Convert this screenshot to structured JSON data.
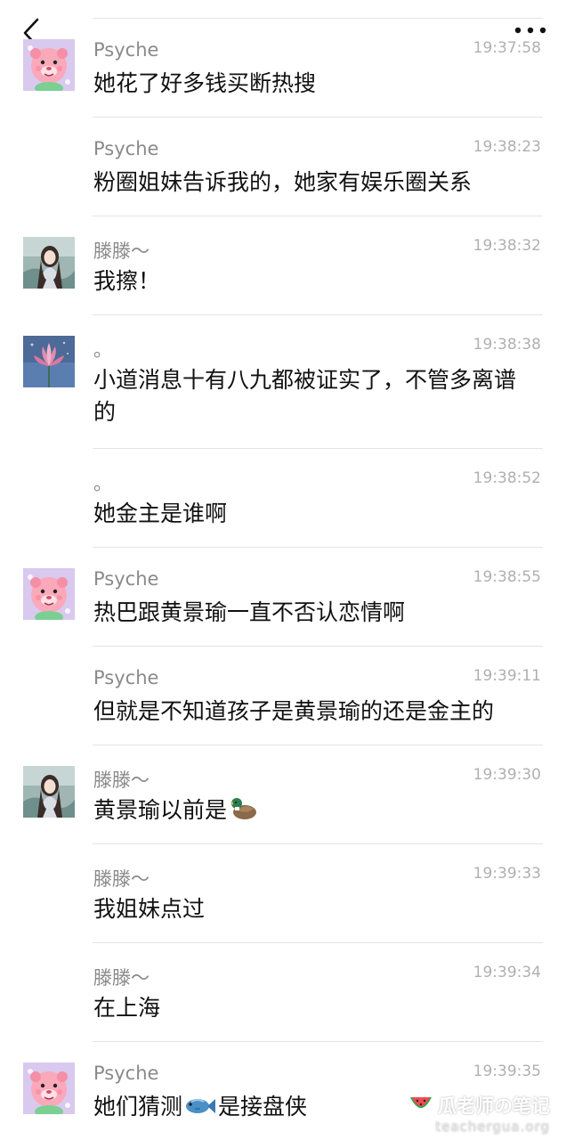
{
  "nav": {
    "back_icon": "chevron-left-icon",
    "more_icon": "more-dots-icon"
  },
  "messages": [
    {
      "sender": "Psyche",
      "time": "19:37:58",
      "text": "她花了好多钱买断热搜",
      "avatar": "pink-cartoon"
    },
    {
      "sender": "Psyche",
      "time": "19:38:23",
      "text": "粉圈姐妹告诉我的，她家有娱乐圈关系",
      "avatar": null
    },
    {
      "sender": "滕滕～",
      "time": "19:38:32",
      "text": "我擦！",
      "avatar": "girl-photo"
    },
    {
      "sender": "。",
      "time": "19:38:38",
      "text": "小道消息十有八九都被证实了，不管多离谱的",
      "avatar": "lotus-photo"
    },
    {
      "sender": "。",
      "time": "19:38:52",
      "text": "她金主是谁啊",
      "avatar": null
    },
    {
      "sender": "Psyche",
      "time": "19:38:55",
      "text": "热巴跟黄景瑜一直不否认恋情啊",
      "avatar": "pink-cartoon"
    },
    {
      "sender": "Psyche",
      "time": "19:39:11",
      "text": "但就是不知道孩子是黄景瑜的还是金主的",
      "avatar": null
    },
    {
      "sender": "滕滕～",
      "time": "19:39:30",
      "text_before": "黄景瑜以前是",
      "emoji": "duck-emoji",
      "text_after": "",
      "avatar": "girl-photo"
    },
    {
      "sender": "滕滕～",
      "time": "19:39:33",
      "text": "我姐妹点过",
      "avatar": null
    },
    {
      "sender": "滕滕～",
      "time": "19:39:34",
      "text": "在上海",
      "avatar": null
    },
    {
      "sender": "Psyche",
      "time": "19:39:35",
      "text_before": "她们猜测",
      "emoji": "fish-emoji",
      "text_after": "是接盘侠",
      "avatar": "pink-cartoon"
    }
  ],
  "watermark": {
    "title": "瓜老师の笔记",
    "url": "teachergua.org",
    "icon": "watermelon-icon"
  },
  "colors": {
    "background": "#ffffff",
    "divider": "#e4e4e4",
    "sender": "#8a8a8a",
    "time": "#b0b0b0",
    "text": "#111111"
  }
}
